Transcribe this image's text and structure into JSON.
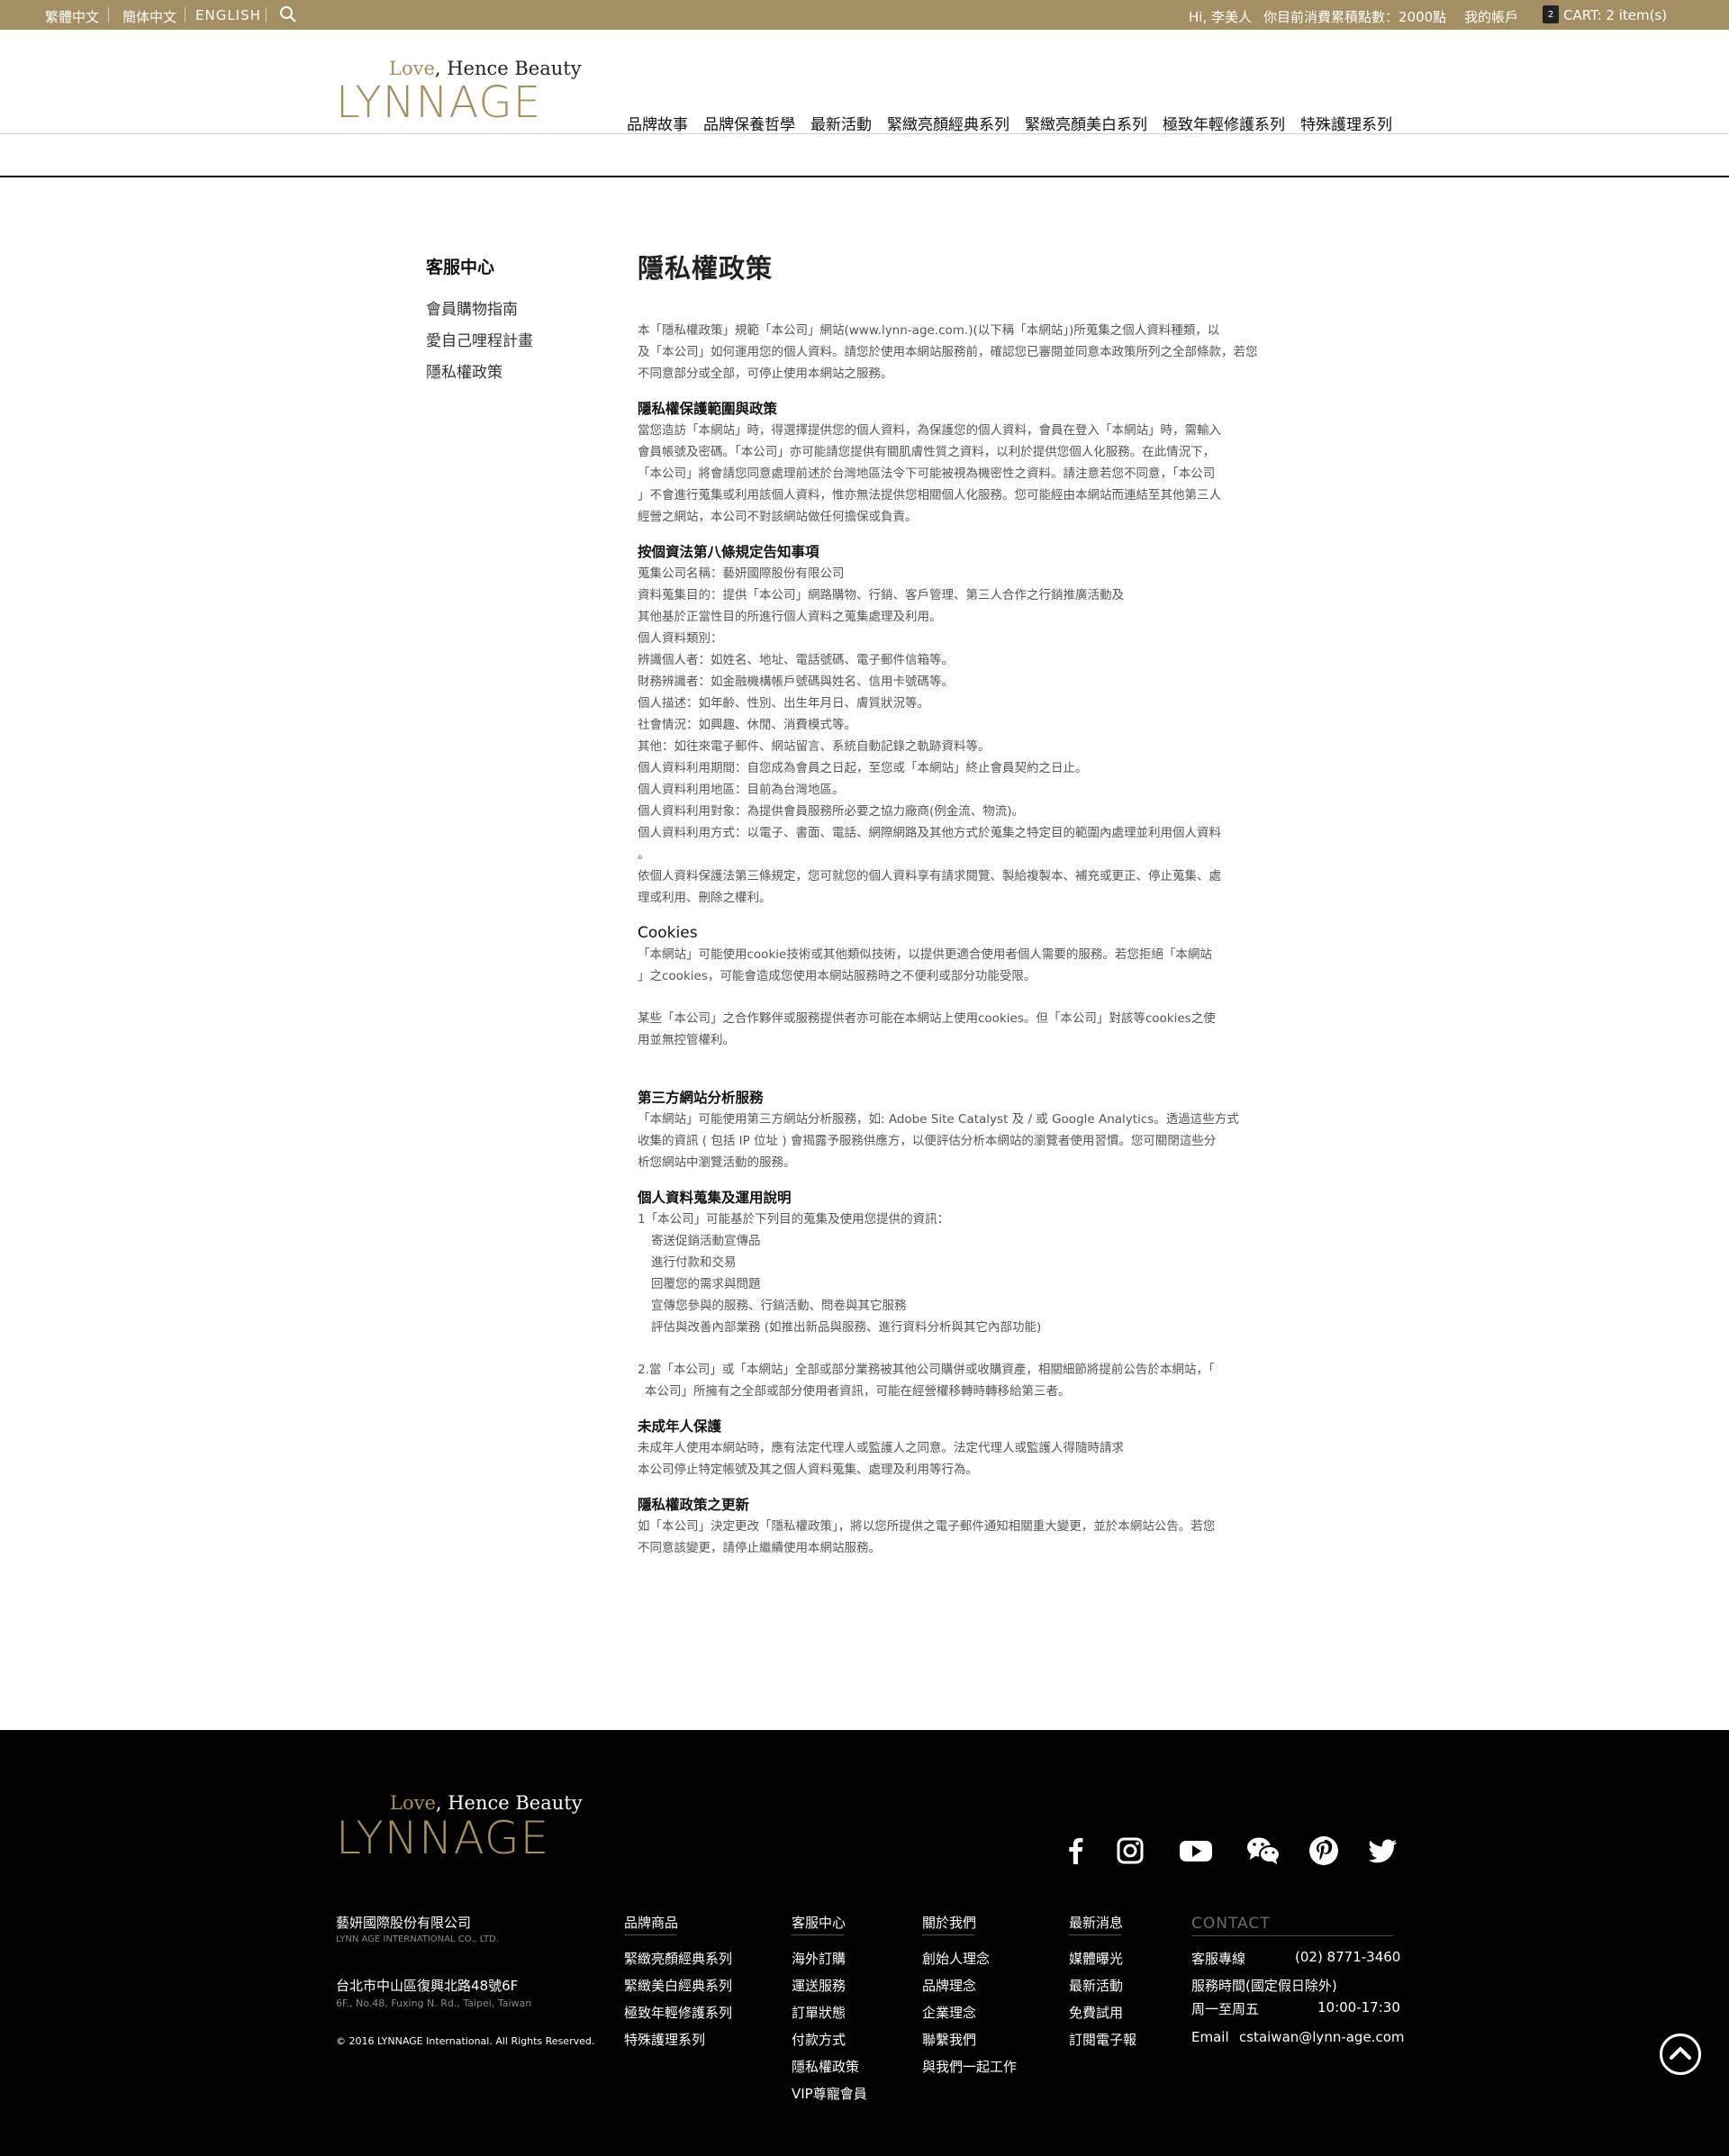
{
  "topbar": {
    "lang_trad": "繁體中文",
    "lang_simp": "簡体中文",
    "lang_en": "ENGLISH",
    "greeting": "Hi, 李美人",
    "points": "你目前消費累積點數：2000點",
    "account": "我的帳戶",
    "cart_count": "2",
    "cart": "CART: 2 item(s)"
  },
  "brand": {
    "tagline_love": "Love",
    "tagline_rest": ", Hence Beauty",
    "name": "LYNNAGE"
  },
  "nav": [
    "品牌故事",
    "品牌保養哲學",
    "最新活動",
    "緊緻亮顏經典系列",
    "緊緻亮顏美白系列",
    "極致年輕修護系列",
    "特殊護理系列"
  ],
  "sidebar": {
    "title": "客服中心",
    "items": [
      "會員購物指南",
      "愛自己哩程計畫",
      "隱私權政策"
    ]
  },
  "content": {
    "title": "隱私權政策",
    "intro": [
      "本「隱私權政策」規範「本公司」網站(www.lynn-age.com.)(以下稱「本網站」)所蒐集之個人資料種類，以",
      "及「本公司」如何運用您的個人資料。請您於使用本網站服務前，確認您已審閱並同意本政策所列之全部條款，若您",
      "不同意部分或全部，可停止使用本網站之服務。"
    ],
    "s1_title": "隱私權保護範圍與政策",
    "s1": [
      "當您造訪「本網站」時，得選擇提供您的個人資料，為保護您的個人資料，會員在登入「本網站」時，需輸入",
      "會員帳號及密碼。「本公司」亦可能請您提供有關肌膚性質之資料，以利於提供您個人化服務。在此情況下，",
      "「本公司」將會請您同意處理前述於台灣地區法令下可能被視為機密性之資料。請注意若您不同意，「本公司",
      "」不會進行蒐集或利用該個人資料，惟亦無法提供您相關個人化服務。您可能經由本網站而連結至其他第三人",
      "經營之網站，本公司不對該網站做任何擔保或負責。"
    ],
    "s2_title": "按個資法第八條規定告知事項",
    "s2": [
      "蒐集公司名稱：藝妍國際股份有限公司",
      "資料蒐集目的：提供「本公司」網路購物、行銷、客戶管理、第三人合作之行銷推廣活動及",
      "其他基於正當性目的所進行個人資料之蒐集處理及利用。",
      "個人資料類別：",
      "辨識個人者：如姓名、地址、電話號碼、電子郵件信箱等。",
      "財務辨識者：如金融機構帳戶號碼與姓名、信用卡號碼等。",
      "個人描述：如年齡、性別、出生年月日、膚質狀況等。",
      "社會情況：如興趣、休閒、消費模式等。",
      "其他：如往來電子郵件、網站留言、系統自動記錄之軌跡資料等。",
      "個人資料利用期間：自您成為會員之日起，至您或「本網站」終止會員契約之日止。",
      "個人資料利用地區：目前為台灣地區。",
      "個人資料利用對象：為提供會員服務所必要之協力廠商(例金流、物流)。",
      "個人資料利用方式：以電子、書面、電話、網際網路及其他方式於蒐集之特定目的範圍內處理並利用個人資料",
      "。",
      "依個人資料保護法第三條規定，您可就您的個人資料享有請求閱覽、製給複製本、補充或更正、停止蒐集、處",
      "理或利用、刪除之權利。"
    ],
    "s3_title": "Cookies",
    "s3a": [
      "「本網站」可能使用cookie技術或其他類似技術，以提供更適合使用者個人需要的服務。若您拒絕「本網站",
      "」之cookies，可能會造成您使用本網站服務時之不便利或部分功能受限。"
    ],
    "s3b": [
      "某些「本公司」之合作夥伴或服務提供者亦可能在本網站上使用cookies。但「本公司」對該等cookies之使",
      "用並無控管權利。"
    ],
    "s4_title": "第三方網站分析服務",
    "s4": [
      "「本網站」可能使用第三方網站分析服務，如: Adobe Site Catalyst 及 / 或 Google Analytics。透過這些方式",
      "收集的資訊 ( 包括 IP 位址 ) 會揭露予服務供應方，以便評估分析本網站的瀏覽者使用習慣。您可關閉這些分",
      "析您網站中瀏覽活動的服務。"
    ],
    "s5_title": "個人資料蒐集及運用說明",
    "s5_lead": "1「本公司」可能基於下列目的蒐集及使用您提供的資訊：",
    "s5_list": [
      "寄送促銷活動宣傳品",
      "進行付款和交易",
      "回覆您的需求與問題",
      "宣傳您參與的服務、行銷活動、問卷與其它服務",
      "評估與改善內部業務 (如推出新品與服務、進行資料分析與其它內部功能)"
    ],
    "s5_p2": [
      "2.當「本公司」或「本網站」全部或部分業務被其他公司購併或收購資產，相關細節將提前公告於本網站，「",
      "本公司」所擁有之全部或部分使用者資訊，可能在經營權移轉時轉移給第三者。"
    ],
    "s6_title": "未成年人保護",
    "s6": [
      "未成年人使用本網站時，應有法定代理人或監護人之同意。法定代理人或監護人得隨時請求",
      "本公司停止特定帳號及其之個人資料蒐集、處理及利用等行為。"
    ],
    "s7_title": "隱私權政策之更新",
    "s7": [
      "如「本公司」決定更改「隱私權政策」，將以您所提供之電子郵件通知相關重大變更，並於本網站公告。若您",
      "不同意該變更，請停止繼續使用本網站服務。"
    ]
  },
  "footer": {
    "social": [
      "facebook-icon",
      "instagram-icon",
      "youtube-icon",
      "wechat-icon",
      "pinterest-icon",
      "twitter-icon"
    ],
    "company": "藝妍國際股份有限公司",
    "company_en": "LYNN AGE INTERNATIONAL CO., LTD.",
    "address": "台北市中山區復興北路48號6F",
    "address_en": "6F., No.48, Fuxing N. Rd., Taipei, Taiwan",
    "copyright": "© 2016 LYNNAGE International. All Rights Reserved.",
    "col1_title": "品牌商品",
    "col1": [
      "緊緻亮顏經典系列",
      "緊緻美白經典系列",
      "極致年輕修護系列",
      "特殊護理系列"
    ],
    "col2_title": "客服中心",
    "col2": [
      "海外訂購",
      "運送服務",
      "訂單狀態",
      "付款方式",
      "隱私權政策",
      "VIP尊寵會員"
    ],
    "col3_title": "關於我們",
    "col3": [
      "創始人理念",
      "品牌理念",
      "企業理念",
      "聯繫我們",
      "與我們一起工作"
    ],
    "col4_title": "最新消息",
    "col4": [
      "媒體曝光",
      "最新活動",
      "免費試用",
      "訂閱電子報"
    ],
    "contact_title": "CONTACT",
    "hotline_label": "客服專線",
    "hotline": "(02) 8771-3460",
    "hours_label": "服務時間(國定假日除外)",
    "days": "周一至周五",
    "hours": "10:00-17:30",
    "email_label": "Email",
    "email": "cstaiwan@lynn-age.com"
  },
  "colors": {
    "gold": "#a48e63",
    "black": "#000000"
  }
}
